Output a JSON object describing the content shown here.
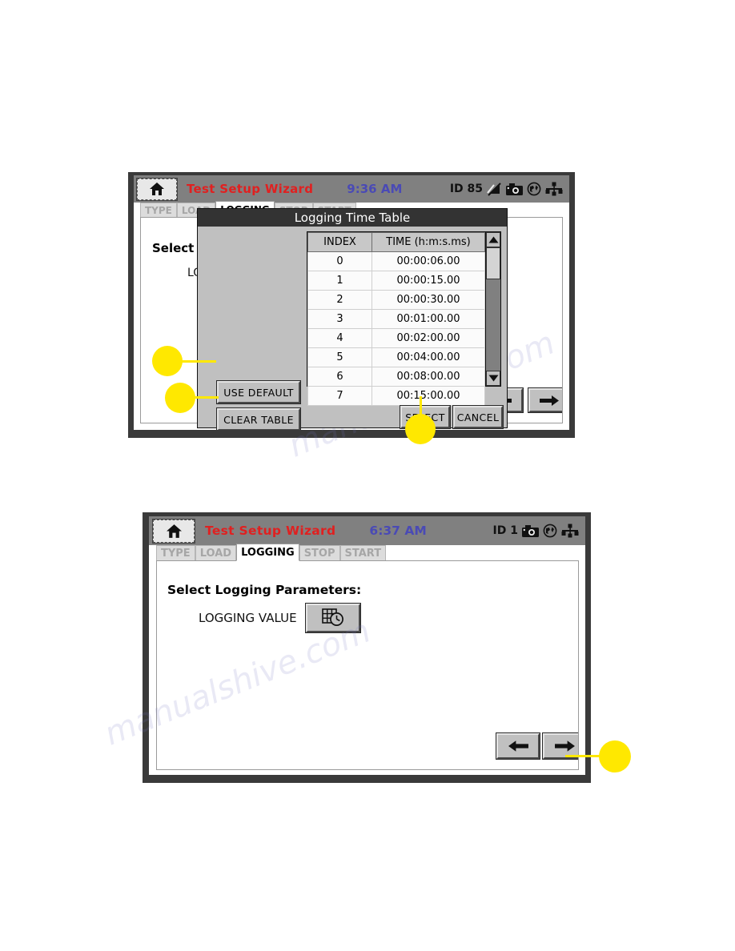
{
  "screen1": {
    "titlebar": {
      "home_icon": "home-icon",
      "title": "Test Setup Wizard",
      "clock": "9:36 AM",
      "status_id": "ID 85",
      "icons": [
        "signal-off-icon",
        "camera-icon",
        "globe-icon",
        "network-icon"
      ]
    },
    "tabs": [
      {
        "label": "TYPE",
        "active": false
      },
      {
        "label": "LOAD",
        "active": false
      },
      {
        "label": "LOGGING",
        "active": true
      },
      {
        "label": "STOP",
        "active": false
      },
      {
        "label": "START",
        "active": false
      }
    ],
    "heading": "Select Logging Parameters:",
    "field_label": "LOGGING VALUE",
    "nav": {
      "back": "back-arrow",
      "next": "next-arrow"
    },
    "dialog": {
      "title": "Logging Time Table",
      "columns": [
        "INDEX",
        "TIME (h:m:s.ms)"
      ],
      "rows": [
        {
          "index": "0",
          "time": "00:00:06.00"
        },
        {
          "index": "1",
          "time": "00:00:15.00"
        },
        {
          "index": "2",
          "time": "00:00:30.00"
        },
        {
          "index": "3",
          "time": "00:01:00.00"
        },
        {
          "index": "4",
          "time": "00:02:00.00"
        },
        {
          "index": "5",
          "time": "00:04:00.00"
        },
        {
          "index": "6",
          "time": "00:08:00.00"
        },
        {
          "index": "7",
          "time": "00:15:00.00"
        }
      ],
      "buttons": {
        "use_default": "USE DEFAULT",
        "clear_table": "CLEAR TABLE",
        "select": "SELECT",
        "cancel": "CANCEL"
      },
      "scroll": {
        "up": "scroll-up-arrow",
        "down": "scroll-down-arrow",
        "thumb_top_pct": 0,
        "thumb_height_pct": 26
      }
    }
  },
  "screen2": {
    "titlebar": {
      "home_icon": "home-icon",
      "title": "Test Setup Wizard",
      "clock": "6:37 AM",
      "status_id": "ID 1",
      "icons": [
        "camera-icon",
        "globe-icon",
        "network-icon"
      ]
    },
    "tabs": [
      {
        "label": "TYPE",
        "active": false
      },
      {
        "label": "LOAD",
        "active": false
      },
      {
        "label": "LOGGING",
        "active": true
      },
      {
        "label": "STOP",
        "active": false
      },
      {
        "label": "START",
        "active": false
      }
    ],
    "heading": "Select Logging Parameters:",
    "field_label": "LOGGING VALUE",
    "logging_value_icon": "table-clock-icon",
    "nav": {
      "back": "back-arrow",
      "next": "next-arrow"
    }
  },
  "callouts": {
    "use_default": "",
    "clear_table": "",
    "select": "",
    "next": ""
  },
  "watermarks": {
    "w1": "manualshive.com",
    "w2": "manualshive.com"
  },
  "colors": {
    "accent_red": "#e02020",
    "clock_blue": "#4a4ab5",
    "callout_yellow": "#ffe800",
    "titlebar_gray": "#808080",
    "bezel": "#3a3a3a",
    "button_face": "#c0c0c0"
  }
}
